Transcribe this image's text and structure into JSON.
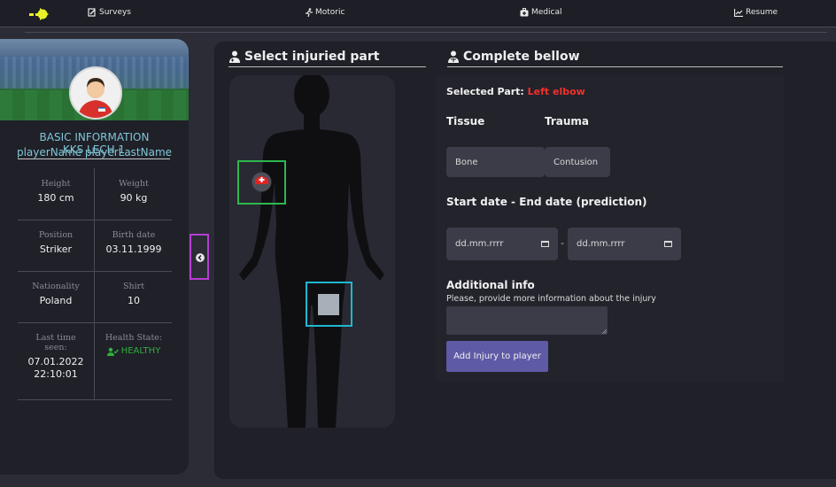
{
  "nav": {
    "surveys": "Surveys",
    "motoric": "Motoric",
    "medical": "Medical",
    "resume": "Resume"
  },
  "profile": {
    "section_title": "BASIC INFORMATION",
    "player_name": "playerName playerLastName",
    "team": "KKS LECH 1",
    "fields": {
      "height_label": "Height",
      "height_value": "180 cm",
      "weight_label": "Weight",
      "weight_value": "90 kg",
      "position_label": "Position",
      "position_value": "Striker",
      "birth_label": "Birth date",
      "birth_value": "03.11.1999",
      "nationality_label": "Nationality",
      "nationality_value": "Poland",
      "shirt_label": "Shirt",
      "shirt_value": "10",
      "last_seen_label": "Last time seen:",
      "last_seen_date": "07.01.2022",
      "last_seen_time": "22:10:01",
      "health_label": "Health State:",
      "health_value": "HEALTHY"
    }
  },
  "injury_selector": {
    "title": "Select injuried part"
  },
  "form": {
    "title": "Complete bellow",
    "selected_part_label": "Selected Part:",
    "selected_part_value": "Left elbow",
    "tissue_label": "Tissue",
    "trauma_label": "Trauma",
    "tissue_value": "Bone",
    "trauma_value": "Contusion",
    "dates_label": "Start date - End date (prediction)",
    "start_placeholder": "dd.mm.rrrr",
    "end_placeholder": "dd.mm.rrrr",
    "date_separator": "-",
    "additional_label": "Additional info",
    "additional_hint": "Please, provide more information about the injury",
    "submit_label": "Add Injury to player"
  },
  "colors": {
    "background": "#2b2c36",
    "panel": "#1f2028",
    "accent_cyan": "#7fc6d6",
    "selected_red": "#f2302b",
    "healthy_green": "#2fae3d",
    "button": "#5e5aa6"
  }
}
